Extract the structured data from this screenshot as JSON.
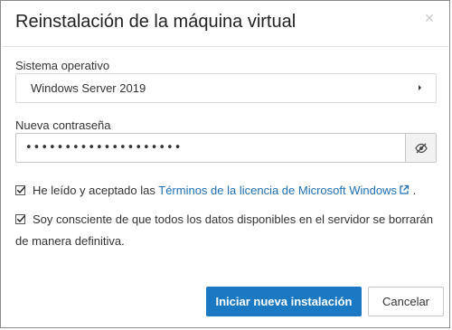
{
  "dialog": {
    "title": "Reinstalación de la máquina virtual",
    "close_icon": "close-icon"
  },
  "os_field": {
    "label": "Sistema operativo",
    "value": "Windows Server 2019"
  },
  "password_field": {
    "label": "Nueva contraseña",
    "value": "••••••••••••••••••••",
    "toggle_icon": "eye-slash-icon"
  },
  "terms_checkbox": {
    "checked": true,
    "text_before": "He leído y aceptado las ",
    "link_text": "Términos de la licencia de Microsoft Windows",
    "link_icon": "external-link-icon",
    "text_after": " ."
  },
  "data_loss_checkbox": {
    "checked": true,
    "text": "Soy consciente de que todos los datos disponibles en el servidor se borrarán de manera definitiva."
  },
  "buttons": {
    "primary_label": "Iniciar nueva instalación",
    "cancel_label": "Cancelar"
  },
  "colors": {
    "primary": "#1b78c2",
    "link": "#1f6fb2"
  }
}
